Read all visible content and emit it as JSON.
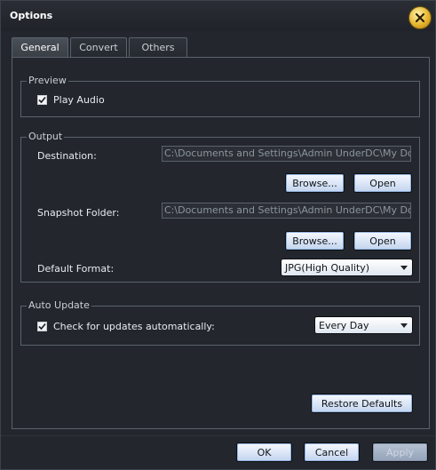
{
  "window": {
    "title": "Options"
  },
  "tabs": [
    {
      "label": "General",
      "active": true
    },
    {
      "label": "Convert",
      "active": false
    },
    {
      "label": "Others",
      "active": false
    }
  ],
  "preview": {
    "group_label": "Preview",
    "play_audio_label": "Play Audio",
    "play_audio_checked": true
  },
  "output": {
    "group_label": "Output",
    "destination_label": "Destination:",
    "destination_value": "C:\\Documents and Settings\\Admin UnderDC\\My Documents",
    "snapshot_label": "Snapshot Folder:",
    "snapshot_value": "C:\\Documents and Settings\\Admin UnderDC\\My Documents",
    "browse_label": "Browse...",
    "open_label": "Open",
    "default_format_label": "Default Format:",
    "default_format_value": "JPG(High Quality)"
  },
  "auto_update": {
    "group_label": "Auto Update",
    "check_label": "Check for updates automatically:",
    "check_checked": true,
    "frequency_value": "Every Day"
  },
  "buttons": {
    "restore_defaults": "Restore Defaults",
    "ok": "OK",
    "cancel": "Cancel",
    "apply": "Apply"
  },
  "colors": {
    "background": "#23272d",
    "accent_button": "#c2d4ee",
    "close_button": "#e6b52c"
  },
  "icons": [
    "close-icon",
    "checkmark-icon",
    "dropdown-arrow-icon"
  ]
}
